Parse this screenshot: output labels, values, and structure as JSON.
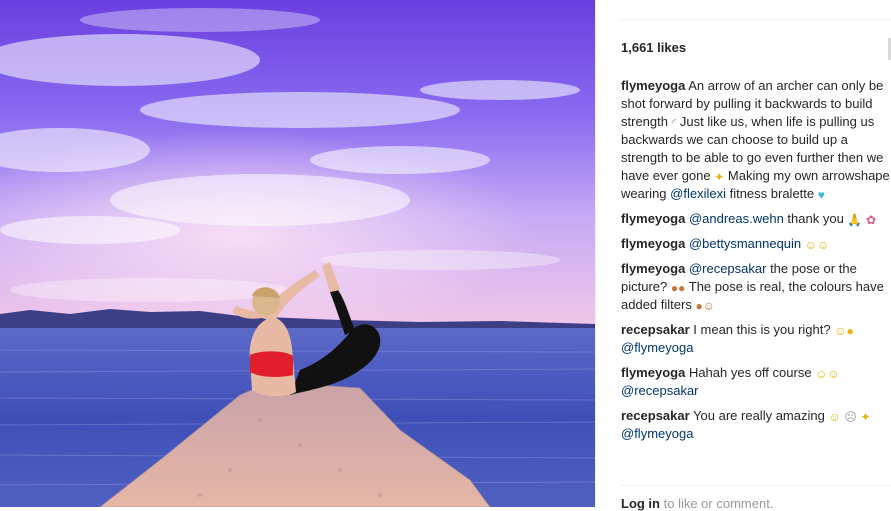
{
  "likes": "1,661 likes",
  "comments": [
    {
      "user": "flymeyoga",
      "parts": [
        {
          "t": "text",
          "v": "An arrow of an archer can only be shot forward by pulling it backwards to build strength "
        },
        {
          "t": "emoji",
          "v": "◜",
          "icon": "bow-emoji",
          "color": "e-grey"
        },
        {
          "t": "text",
          "v": " Just like us, when life is pulling us backwards we can choose to build up a strength to be able to go even further then we have ever gone "
        },
        {
          "t": "emoji",
          "v": "✦",
          "icon": "sparkle-emoji",
          "color": "e-yellow"
        },
        {
          "t": "text",
          "v": " Making my own arrowshape wearing "
        },
        {
          "t": "mention",
          "v": "@flexilexi"
        },
        {
          "t": "text",
          "v": "  fitness bralette "
        },
        {
          "t": "emoji",
          "v": "♥",
          "icon": "blue-heart-emoji",
          "color": "e-blue"
        }
      ]
    },
    {
      "user": "flymeyoga",
      "parts": [
        {
          "t": "mention",
          "v": "@andreas.wehn"
        },
        {
          "t": "text",
          "v": " thank you "
        },
        {
          "t": "emoji",
          "v": "🙏",
          "icon": "praying-hands-emoji",
          "color": "e-yellow"
        },
        {
          "t": "text",
          "v": " "
        },
        {
          "t": "emoji",
          "v": "✿",
          "icon": "tulip-emoji",
          "color": "e-pink"
        }
      ]
    },
    {
      "user": "flymeyoga",
      "parts": [
        {
          "t": "mention",
          "v": "@bettysmannequin"
        },
        {
          "t": "text",
          "v": " "
        },
        {
          "t": "emoji",
          "v": "☺☺",
          "icon": "hugging-faces-emoji",
          "color": "e-yellow"
        }
      ]
    },
    {
      "user": "flymeyoga",
      "parts": [
        {
          "t": "mention",
          "v": "@recepsakar"
        },
        {
          "t": "text",
          "v": " the pose or the picture? "
        },
        {
          "t": "emoji",
          "v": "●●",
          "icon": "see-no-evil-monkeys-emoji",
          "color": "e-orange"
        },
        {
          "t": "text",
          "v": " The pose is real, the colours have added filters "
        },
        {
          "t": "emoji",
          "v": "●☺",
          "icon": "monkey-and-grin-emoji",
          "color": "e-orange"
        }
      ]
    },
    {
      "user": "recepsakar",
      "parts": [
        {
          "t": "text",
          "v": "I mean this is you right? "
        },
        {
          "t": "emoji",
          "v": "☺●",
          "icon": "laughing-and-monkey-emoji",
          "color": "e-yellow"
        },
        {
          "t": "text",
          "v": " "
        },
        {
          "t": "mention",
          "v": "@flymeyoga"
        }
      ]
    },
    {
      "user": "flymeyoga",
      "parts": [
        {
          "t": "text",
          "v": "Hahah yes off course "
        },
        {
          "t": "emoji",
          "v": "☺☺",
          "icon": "smiling-faces-emoji",
          "color": "e-yellow"
        },
        {
          "t": "text",
          "v": " "
        },
        {
          "t": "mention",
          "v": "@recepsakar"
        }
      ]
    },
    {
      "user": "recepsakar",
      "parts": [
        {
          "t": "text",
          "v": "You are really amazing "
        },
        {
          "t": "emoji",
          "v": "☺",
          "icon": "heart-eyes-emoji",
          "color": "e-yellow"
        },
        {
          "t": "text",
          "v": " "
        },
        {
          "t": "emoji",
          "v": "☹",
          "icon": "small-face-emoji",
          "color": "e-grey"
        },
        {
          "t": "text",
          "v": " "
        },
        {
          "t": "emoji",
          "v": "✦",
          "icon": "sparkle-emoji",
          "color": "e-yellow"
        },
        {
          "t": "text",
          "v": " "
        },
        {
          "t": "mention",
          "v": "@flymeyoga"
        }
      ]
    }
  ],
  "footer": {
    "login_link": "Log in",
    "login_text": " to like or comment."
  }
}
